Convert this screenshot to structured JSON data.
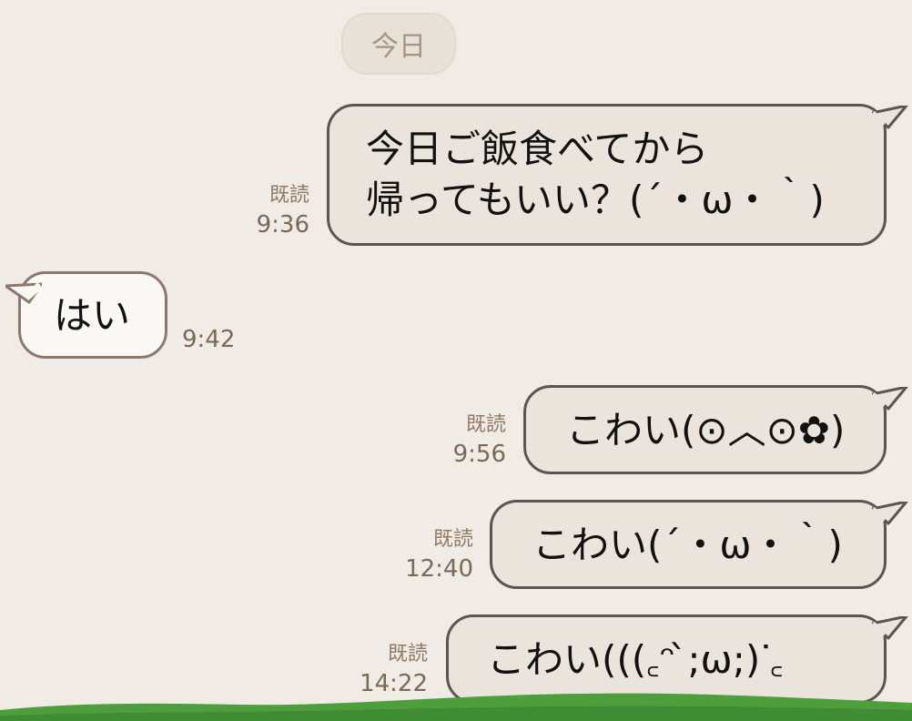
{
  "date_divider": "今日",
  "messages": [
    {
      "direction": "outgoing",
      "text": "今日ご飯食べてから\n帰ってもいい？(´・ω・｀)",
      "read": "既読",
      "time": "9:36"
    },
    {
      "direction": "incoming",
      "text": "はい",
      "time": "9:42"
    },
    {
      "direction": "outgoing",
      "text": "こわい(⊙︿⊙✿)",
      "read": "既読",
      "time": "9:56"
    },
    {
      "direction": "outgoing",
      "text": "こわい(´・ω・｀)",
      "read": "既読",
      "time": "12:40"
    },
    {
      "direction": "outgoing",
      "text": "こわい(((꜀ᵔ ̀;ω;)ᐝ꜀",
      "read": "既読",
      "time": "14:22"
    }
  ],
  "colors": {
    "background": "#f0ebe4",
    "outgoing_bubble": "#eae4dc",
    "incoming_bubble": "#faf8f5",
    "timestamp": "#7b6957",
    "grass": "#4f9e3e"
  }
}
